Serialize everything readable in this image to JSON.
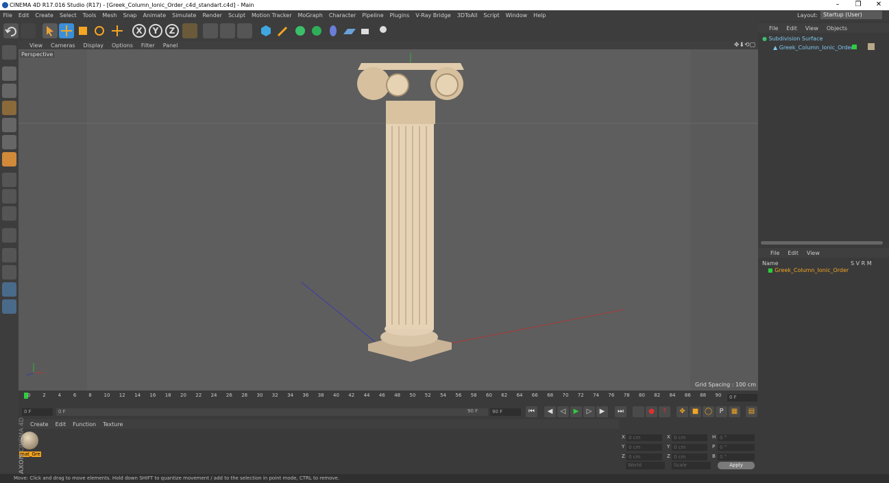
{
  "window": {
    "title": "CINEMA 4D R17.016 Studio (R17) - [Greek_Column_Ionic_Order_c4d_standart.c4d] - Main",
    "minimize": "–",
    "restore": "❐",
    "close": "✕"
  },
  "menu": [
    "File",
    "Edit",
    "Create",
    "Select",
    "Tools",
    "Mesh",
    "Snap",
    "Animate",
    "Simulate",
    "Render",
    "Sculpt",
    "Motion Tracker",
    "MoGraph",
    "Character",
    "Pipeline",
    "Plugins",
    "V-Ray Bridge",
    "3DToAll",
    "Script",
    "Window",
    "Help"
  ],
  "layout": {
    "label": "Layout:",
    "value": "Startup (User)"
  },
  "toolbar": {
    "axis_x": "X",
    "axis_y": "Y",
    "axis_z": "Z"
  },
  "viewport": {
    "menu": [
      "View",
      "Cameras",
      "Display",
      "Options",
      "Filter",
      "Panel"
    ],
    "camera_label": "Perspective",
    "grid_spacing": "Grid Spacing : 100 cm"
  },
  "timeline": {
    "ticks": [
      "0",
      "2",
      "4",
      "6",
      "8",
      "10",
      "12",
      "14",
      "16",
      "18",
      "20",
      "22",
      "24",
      "26",
      "28",
      "30",
      "32",
      "34",
      "36",
      "38",
      "40",
      "42",
      "44",
      "46",
      "48",
      "50",
      "52",
      "54",
      "56",
      "58",
      "60",
      "62",
      "64",
      "66",
      "68",
      "70",
      "72",
      "74",
      "76",
      "78",
      "80",
      "82",
      "84",
      "86",
      "88",
      "90"
    ],
    "current_frame_right": "0 F",
    "start_field": "0 F",
    "slider_start": "0 F",
    "slider_end": "90 F",
    "end_field": "90 F"
  },
  "material_panel": {
    "menu": [
      "Create",
      "Edit",
      "Function",
      "Texture"
    ],
    "material_name": "mat_Gre"
  },
  "coordinates": {
    "rows": [
      {
        "a": "X",
        "av": "0 cm",
        "b": "X",
        "bv": "0 cm",
        "c": "H",
        "cv": "0 °"
      },
      {
        "a": "Y",
        "av": "0 cm",
        "b": "Y",
        "bv": "0 cm",
        "c": "P",
        "cv": "0 °"
      },
      {
        "a": "Z",
        "av": "0 cm",
        "b": "Z",
        "bv": "0 cm",
        "c": "B",
        "cv": "0 °"
      }
    ],
    "mode1": "World",
    "mode2": "Scale",
    "apply": "Apply"
  },
  "object_manager": {
    "menu": [
      "File",
      "Edit",
      "View",
      "Objects"
    ],
    "objects": [
      "Subdivision Surface",
      "Greek_Column_Ionic_Order"
    ]
  },
  "layer_manager": {
    "menu": [
      "File",
      "Edit",
      "View"
    ],
    "header_name": "Name",
    "header_flags": "S V R M",
    "items": [
      "Greek_Column_Ionic_Order"
    ]
  },
  "status": "Move: Click and drag to move elements. Hold down SHIFT to quantize movement / add to the selection in point mode, CTRL to remove.",
  "brand": {
    "line1": "MAXON",
    "line2": "CINEMA 4D"
  },
  "colors": {
    "accent_orange": "#f5a623",
    "active_blue": "#3b8fd8",
    "green_keyframe": "#2ecc40"
  }
}
